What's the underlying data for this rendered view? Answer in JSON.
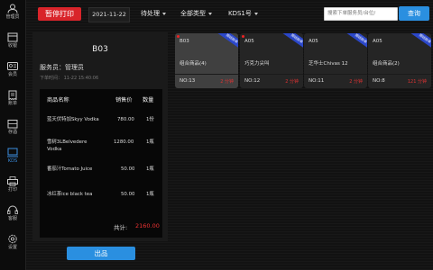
{
  "sidebar": {
    "items": [
      {
        "label": "管理员",
        "icon": "user-icon"
      },
      {
        "label": "收银",
        "icon": "cashier-icon"
      },
      {
        "label": "会员",
        "icon": "member-icon"
      },
      {
        "label": "账单",
        "icon": "bill-icon"
      },
      {
        "label": "存酒",
        "icon": "wine-storage-icon"
      },
      {
        "label": "KDS",
        "icon": "monitor-icon",
        "active": true
      },
      {
        "label": "打印",
        "icon": "printer-icon"
      },
      {
        "label": "客服",
        "icon": "headset-icon"
      },
      {
        "label": "设置",
        "icon": "settings-icon"
      }
    ]
  },
  "toolbar": {
    "pause_print": "暂停打印",
    "date": "2021-11-22",
    "status_filter": "待处理",
    "type_filter": "全部类型",
    "kds_filter": "KDS1号",
    "search_placeholder": "搜索下单服务员/台位/",
    "search_label": "查询"
  },
  "detail": {
    "table_no": "B03",
    "waiter_label": "服务员：",
    "waiter_name": "管理员",
    "order_time": "下单时间： 11-22 15:40:06",
    "headers": {
      "name": "商品名称",
      "price": "销售价",
      "qty": "数量"
    },
    "items": [
      {
        "name_line1": "蓝天伏特加Skyy Vodka",
        "name_line2": "",
        "price": "780.00",
        "qty": "1份"
      },
      {
        "name_line1": "雪树3LBelvedere",
        "name_line2": "Vodka",
        "price": "1280.00",
        "qty": "1瓶"
      },
      {
        "name_line1": "番茄汁Tomato Juice",
        "name_line2": "",
        "price": "50.00",
        "qty": "1瓶"
      },
      {
        "name_line1": "冰红茶ice black tea",
        "name_line2": "",
        "price": "50.00",
        "qty": "1瓶"
      }
    ],
    "total_label": "共计:",
    "total_value": "2160.00",
    "serve_button": "出品"
  },
  "orders": [
    {
      "table": "B03",
      "item": "组合商品(4)",
      "no": "NO:13",
      "minutes": "2 分钟",
      "ribbon": "预结账单",
      "selected": true,
      "red_dot": true
    },
    {
      "table": "A05",
      "item": "巧克力尖叫",
      "no": "NO:12",
      "minutes": "2 分钟",
      "ribbon": "预结账单",
      "selected": false,
      "red_dot": true
    },
    {
      "table": "A05",
      "item": "芝华士Chivas 12",
      "no": "NO:11",
      "minutes": "2 分钟",
      "ribbon": "预结账单",
      "selected": false,
      "red_dot": false
    },
    {
      "table": "A05",
      "item": "组合商品(2)",
      "no": "NO:8",
      "minutes": "121 分钟",
      "ribbon": "预结账单",
      "selected": false,
      "red_dot": false
    }
  ],
  "colors": {
    "accent_blue": "#2a8fe0",
    "danger_red": "#d9242a",
    "ribbon_blue": "#2b47c9"
  }
}
